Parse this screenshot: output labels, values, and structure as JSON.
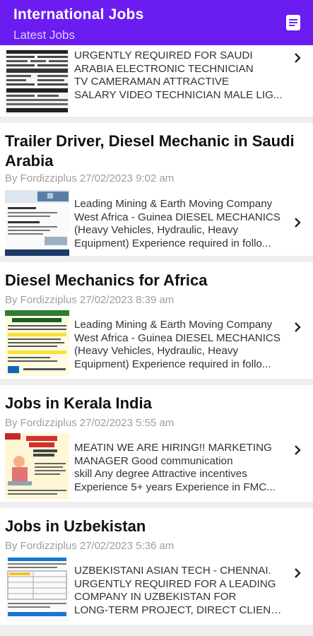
{
  "app": {
    "title": "International Jobs",
    "subtitle": "Latest Jobs",
    "menu_icon": "document-list-icon",
    "colors": {
      "appbar": "#6b1df1",
      "subtitle": "#dcd0ff",
      "background": "#eeeeee",
      "card": "#ffffff",
      "byline": "#9e9e9e"
    }
  },
  "posts": [
    {
      "title": "",
      "byline": "",
      "excerpt": [
        "URGENTLY REQUIRED FOR SAUDI",
        "ARABIA ELECTRONIC TECHNICIAN",
        "TV CAMERAMAN ATTRACTIVE",
        "SALARY VIDEO TECHNICIAN MALE LIG..."
      ],
      "thumbnail": "newspaper-job-ad-image"
    },
    {
      "title": "Trailer Driver, Diesel Mechanic in Saudi Arabia",
      "byline": "By Fordizziplus 27/02/2023 9:02 am",
      "excerpt": [
        "Leading Mining & Earth Moving Company",
        "West Africa - Guinea DIESEL MECHANICS",
        "(Heavy Vehicles, Hydraulic, Heavy",
        "Equipment) Experience required in follo..."
      ],
      "thumbnail": "trailer-driver-ad-image"
    },
    {
      "title": "Diesel Mechanics for Africa",
      "byline": "By Fordizziplus 27/02/2023 8:39 am",
      "excerpt": [
        "Leading Mining & Earth Moving Company",
        "West Africa - Guinea DIESEL MECHANICS",
        "(Heavy Vehicles, Hydraulic, Heavy",
        "Equipment) Experience required in follo..."
      ],
      "thumbnail": "diesel-mechanics-ad-image"
    },
    {
      "title": "Jobs in Kerala India",
      "byline": "By Fordizziplus 27/02/2023 5:55 am",
      "excerpt": [
        "MEATIN WE ARE HIRING!! MARKETING",
        "MANAGER Good communication",
        "skill Any degree Attractive incentives",
        "Experience 5+ years Experience in FMC..."
      ],
      "thumbnail": "we-are-hiring-ad-image"
    },
    {
      "title": "Jobs in Uzbekistan",
      "byline": "By Fordizziplus 27/02/2023 5:36 am",
      "excerpt": [
        "UZBEKISTANI ASIAN TECH - CHENNAI.",
        "URGENTLY REQUIRED FOR A LEADING",
        "COMPANY IN UZBEKISTAN FOR",
        "LONG-TERM PROJECT, DIRECT CLIENT ..."
      ],
      "thumbnail": "uzbekistan-ad-image"
    }
  ]
}
